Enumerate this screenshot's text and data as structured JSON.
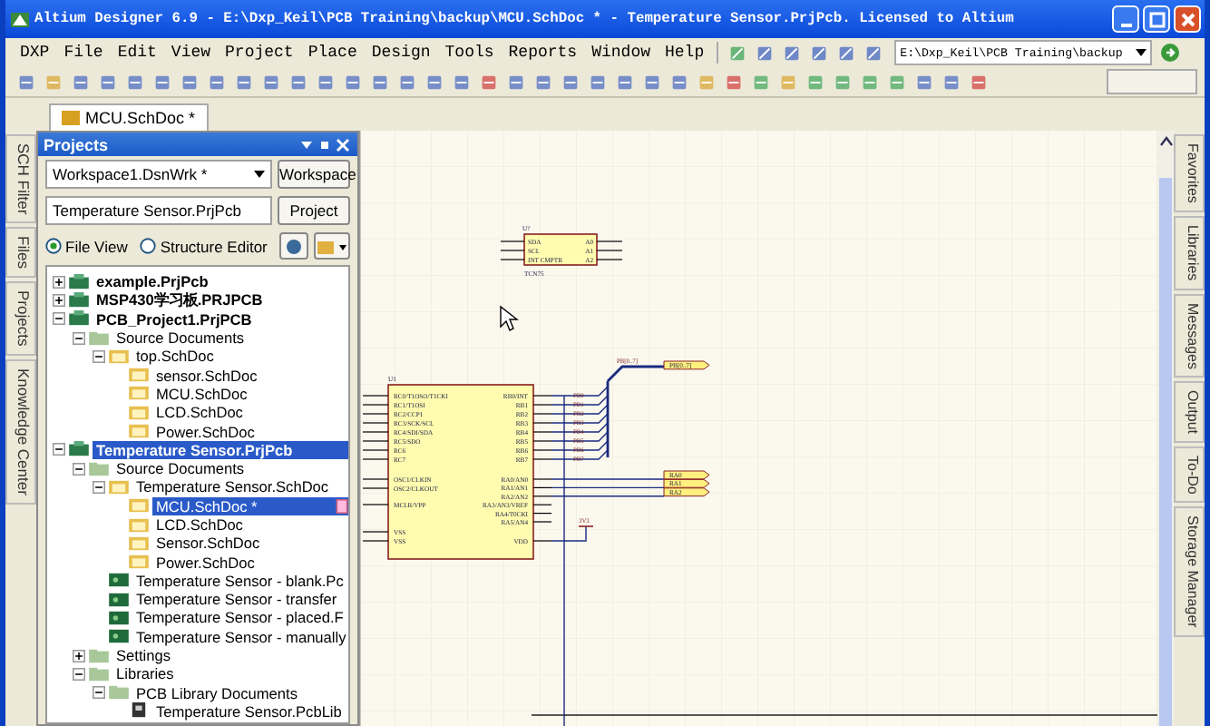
{
  "window": {
    "title": "Altium Designer 6.9 - E:\\Dxp_Keil\\PCB Training\\backup\\MCU.SchDoc * - Temperature Sensor.PrjPcb. Licensed to Altium"
  },
  "menu": [
    "DXP",
    "File",
    "Edit",
    "View",
    "Project",
    "Place",
    "Design",
    "Tools",
    "Reports",
    "Window",
    "Help"
  ],
  "path_field": {
    "value": "E:\\Dxp_Keil\\PCB Training\\backup"
  },
  "left_tabs": [
    "SCH Filter",
    "Files",
    "Projects",
    "Knowledge Center"
  ],
  "right_tabs": [
    "Favorites",
    "Libraries",
    "Messages",
    "Output",
    "To-Do",
    "Storage Manager"
  ],
  "document_tabs": [
    {
      "label": "MCU.SchDoc *",
      "selected": true
    }
  ],
  "projects_panel": {
    "title": "Projects",
    "workspace": {
      "value": "Workspace1.DsnWrk *"
    },
    "workspace_button": "Workspace",
    "project": {
      "value": "Temperature Sensor.PrjPcb"
    },
    "project_button": "Project",
    "views": [
      {
        "label": "File View",
        "selected": true
      },
      {
        "label": "Structure Editor",
        "selected": false
      }
    ],
    "tree": [
      {
        "label": "example.PrjPcb",
        "kind": "project",
        "expanded": false,
        "selected": false
      },
      {
        "label": "MSP430学习板.PRJPCB",
        "kind": "project",
        "expanded": false,
        "selected": false
      },
      {
        "label": "PCB_Project1.PrjPCB",
        "kind": "project",
        "expanded": true,
        "selected": false,
        "children": [
          {
            "label": "Source Documents",
            "kind": "folder",
            "expanded": true,
            "selected": false,
            "children": [
              {
                "label": "top.SchDoc",
                "kind": "sheet",
                "expanded": true,
                "selected": false,
                "children": [
                  {
                    "label": "sensor.SchDoc",
                    "kind": "sheet",
                    "selected": false
                  },
                  {
                    "label": "MCU.SchDoc",
                    "kind": "sheet",
                    "selected": false
                  },
                  {
                    "label": "LCD.SchDoc",
                    "kind": "sheet",
                    "selected": false
                  },
                  {
                    "label": "Power.SchDoc",
                    "kind": "sheet",
                    "selected": false
                  }
                ]
              }
            ]
          }
        ]
      },
      {
        "label": "Temperature Sensor.PrjPcb",
        "kind": "project",
        "expanded": true,
        "selected": true,
        "children": [
          {
            "label": "Source Documents",
            "kind": "folder",
            "expanded": true,
            "selected": false,
            "children": [
              {
                "label": "Temperature Sensor.SchDoc",
                "kind": "sheet",
                "expanded": true,
                "selected": false,
                "children": [
                  {
                    "label": "MCU.SchDoc *",
                    "kind": "sheet",
                    "selected": true,
                    "modified": true
                  },
                  {
                    "label": "LCD.SchDoc",
                    "kind": "sheet",
                    "selected": false
                  },
                  {
                    "label": "Sensor.SchDoc",
                    "kind": "sheet",
                    "selected": false
                  },
                  {
                    "label": "Power.SchDoc",
                    "kind": "sheet",
                    "selected": false
                  }
                ]
              },
              {
                "label": "Temperature Sensor - blank.Pc",
                "kind": "pcb",
                "selected": false
              },
              {
                "label": "Temperature Sensor - transfer",
                "kind": "pcb",
                "selected": false
              },
              {
                "label": "Temperature Sensor - placed.F",
                "kind": "pcb",
                "selected": false
              },
              {
                "label": "Temperature Sensor - manually",
                "kind": "pcb",
                "selected": false
              }
            ]
          },
          {
            "label": "Settings",
            "kind": "folder",
            "expanded": false,
            "selected": false
          },
          {
            "label": "Libraries",
            "kind": "folder",
            "expanded": true,
            "selected": false,
            "children": [
              {
                "label": "PCB Library Documents",
                "kind": "folder",
                "expanded": true,
                "selected": false,
                "children": [
                  {
                    "label": "Temperature Sensor.PcbLib",
                    "kind": "library",
                    "selected": false
                  }
                ]
              }
            ]
          }
        ]
      }
    ]
  },
  "schematic": {
    "sensor": {
      "designator": "U?",
      "part": "TCN75",
      "left_pins": [
        "SDA",
        "SCL",
        "INT CMPTR"
      ],
      "right_pins": [
        "A0",
        "A1",
        "A2"
      ]
    },
    "mcu": {
      "designator": "U1",
      "left_pins": [
        "RC0/T1OSO/T1CKI",
        "RC1/T1OSI",
        "RC2/CCP1",
        "RC3/SCK/SCL",
        "RC4/SDI/SDA",
        "RC5/SDO",
        "RC6",
        "RC7",
        "OSC1/CLKIN",
        "OSC2/CLKOUT",
        "MCLR/VPP",
        "VSS",
        "VSS"
      ],
      "right_pins": [
        "RB0/INT",
        "RB1",
        "RB2",
        "RB3",
        "RB4",
        "RB5",
        "RB6",
        "RB7",
        "RA0/AN0",
        "RA1/AN1",
        "RA2/AN2",
        "RA3/AN3/VREF",
        "RA4/T0CKI",
        "RA5/AN4",
        "VDD"
      ]
    },
    "net_labels": [
      "PB0",
      "PB1",
      "PB2",
      "PB3",
      "PB4",
      "PB5",
      "PB6",
      "PB7"
    ],
    "bus_label": "PB[0..7]",
    "ports": [
      "PB[0..7]",
      "RA0",
      "RA1",
      "RA2"
    ],
    "power": "3V3"
  }
}
